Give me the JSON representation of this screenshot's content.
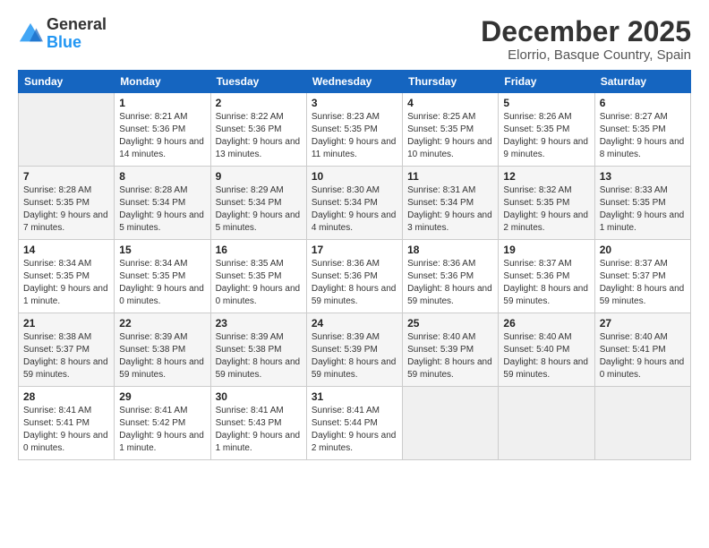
{
  "logo": {
    "general": "General",
    "blue": "Blue"
  },
  "header": {
    "title": "December 2025",
    "subtitle": "Elorrio, Basque Country, Spain"
  },
  "weekdays": [
    "Sunday",
    "Monday",
    "Tuesday",
    "Wednesday",
    "Thursday",
    "Friday",
    "Saturday"
  ],
  "weeks": [
    [
      {
        "day": "",
        "sunrise": "",
        "sunset": "",
        "daylight": ""
      },
      {
        "day": "1",
        "sunrise": "Sunrise: 8:21 AM",
        "sunset": "Sunset: 5:36 PM",
        "daylight": "Daylight: 9 hours and 14 minutes."
      },
      {
        "day": "2",
        "sunrise": "Sunrise: 8:22 AM",
        "sunset": "Sunset: 5:36 PM",
        "daylight": "Daylight: 9 hours and 13 minutes."
      },
      {
        "day": "3",
        "sunrise": "Sunrise: 8:23 AM",
        "sunset": "Sunset: 5:35 PM",
        "daylight": "Daylight: 9 hours and 11 minutes."
      },
      {
        "day": "4",
        "sunrise": "Sunrise: 8:25 AM",
        "sunset": "Sunset: 5:35 PM",
        "daylight": "Daylight: 9 hours and 10 minutes."
      },
      {
        "day": "5",
        "sunrise": "Sunrise: 8:26 AM",
        "sunset": "Sunset: 5:35 PM",
        "daylight": "Daylight: 9 hours and 9 minutes."
      },
      {
        "day": "6",
        "sunrise": "Sunrise: 8:27 AM",
        "sunset": "Sunset: 5:35 PM",
        "daylight": "Daylight: 9 hours and 8 minutes."
      }
    ],
    [
      {
        "day": "7",
        "sunrise": "Sunrise: 8:28 AM",
        "sunset": "Sunset: 5:35 PM",
        "daylight": "Daylight: 9 hours and 7 minutes."
      },
      {
        "day": "8",
        "sunrise": "Sunrise: 8:28 AM",
        "sunset": "Sunset: 5:34 PM",
        "daylight": "Daylight: 9 hours and 5 minutes."
      },
      {
        "day": "9",
        "sunrise": "Sunrise: 8:29 AM",
        "sunset": "Sunset: 5:34 PM",
        "daylight": "Daylight: 9 hours and 5 minutes."
      },
      {
        "day": "10",
        "sunrise": "Sunrise: 8:30 AM",
        "sunset": "Sunset: 5:34 PM",
        "daylight": "Daylight: 9 hours and 4 minutes."
      },
      {
        "day": "11",
        "sunrise": "Sunrise: 8:31 AM",
        "sunset": "Sunset: 5:34 PM",
        "daylight": "Daylight: 9 hours and 3 minutes."
      },
      {
        "day": "12",
        "sunrise": "Sunrise: 8:32 AM",
        "sunset": "Sunset: 5:35 PM",
        "daylight": "Daylight: 9 hours and 2 minutes."
      },
      {
        "day": "13",
        "sunrise": "Sunrise: 8:33 AM",
        "sunset": "Sunset: 5:35 PM",
        "daylight": "Daylight: 9 hours and 1 minute."
      }
    ],
    [
      {
        "day": "14",
        "sunrise": "Sunrise: 8:34 AM",
        "sunset": "Sunset: 5:35 PM",
        "daylight": "Daylight: 9 hours and 1 minute."
      },
      {
        "day": "15",
        "sunrise": "Sunrise: 8:34 AM",
        "sunset": "Sunset: 5:35 PM",
        "daylight": "Daylight: 9 hours and 0 minutes."
      },
      {
        "day": "16",
        "sunrise": "Sunrise: 8:35 AM",
        "sunset": "Sunset: 5:35 PM",
        "daylight": "Daylight: 9 hours and 0 minutes."
      },
      {
        "day": "17",
        "sunrise": "Sunrise: 8:36 AM",
        "sunset": "Sunset: 5:36 PM",
        "daylight": "Daylight: 8 hours and 59 minutes."
      },
      {
        "day": "18",
        "sunrise": "Sunrise: 8:36 AM",
        "sunset": "Sunset: 5:36 PM",
        "daylight": "Daylight: 8 hours and 59 minutes."
      },
      {
        "day": "19",
        "sunrise": "Sunrise: 8:37 AM",
        "sunset": "Sunset: 5:36 PM",
        "daylight": "Daylight: 8 hours and 59 minutes."
      },
      {
        "day": "20",
        "sunrise": "Sunrise: 8:37 AM",
        "sunset": "Sunset: 5:37 PM",
        "daylight": "Daylight: 8 hours and 59 minutes."
      }
    ],
    [
      {
        "day": "21",
        "sunrise": "Sunrise: 8:38 AM",
        "sunset": "Sunset: 5:37 PM",
        "daylight": "Daylight: 8 hours and 59 minutes."
      },
      {
        "day": "22",
        "sunrise": "Sunrise: 8:39 AM",
        "sunset": "Sunset: 5:38 PM",
        "daylight": "Daylight: 8 hours and 59 minutes."
      },
      {
        "day": "23",
        "sunrise": "Sunrise: 8:39 AM",
        "sunset": "Sunset: 5:38 PM",
        "daylight": "Daylight: 8 hours and 59 minutes."
      },
      {
        "day": "24",
        "sunrise": "Sunrise: 8:39 AM",
        "sunset": "Sunset: 5:39 PM",
        "daylight": "Daylight: 8 hours and 59 minutes."
      },
      {
        "day": "25",
        "sunrise": "Sunrise: 8:40 AM",
        "sunset": "Sunset: 5:39 PM",
        "daylight": "Daylight: 8 hours and 59 minutes."
      },
      {
        "day": "26",
        "sunrise": "Sunrise: 8:40 AM",
        "sunset": "Sunset: 5:40 PM",
        "daylight": "Daylight: 8 hours and 59 minutes."
      },
      {
        "day": "27",
        "sunrise": "Sunrise: 8:40 AM",
        "sunset": "Sunset: 5:41 PM",
        "daylight": "Daylight: 9 hours and 0 minutes."
      }
    ],
    [
      {
        "day": "28",
        "sunrise": "Sunrise: 8:41 AM",
        "sunset": "Sunset: 5:41 PM",
        "daylight": "Daylight: 9 hours and 0 minutes."
      },
      {
        "day": "29",
        "sunrise": "Sunrise: 8:41 AM",
        "sunset": "Sunset: 5:42 PM",
        "daylight": "Daylight: 9 hours and 1 minute."
      },
      {
        "day": "30",
        "sunrise": "Sunrise: 8:41 AM",
        "sunset": "Sunset: 5:43 PM",
        "daylight": "Daylight: 9 hours and 1 minute."
      },
      {
        "day": "31",
        "sunrise": "Sunrise: 8:41 AM",
        "sunset": "Sunset: 5:44 PM",
        "daylight": "Daylight: 9 hours and 2 minutes."
      },
      {
        "day": "",
        "sunrise": "",
        "sunset": "",
        "daylight": ""
      },
      {
        "day": "",
        "sunrise": "",
        "sunset": "",
        "daylight": ""
      },
      {
        "day": "",
        "sunrise": "",
        "sunset": "",
        "daylight": ""
      }
    ]
  ]
}
